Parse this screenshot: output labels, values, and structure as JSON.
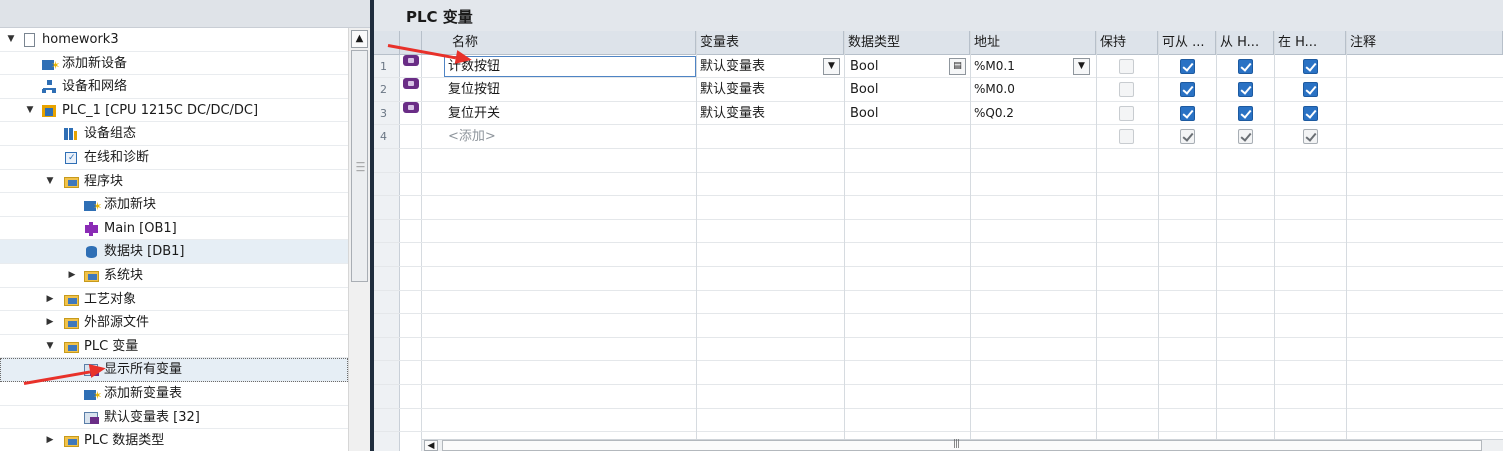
{
  "editor": {
    "title": "PLC 变量"
  },
  "tree": {
    "items": [
      {
        "label": "homework3",
        "level": 0,
        "toggle": "▼",
        "icon": "project-file-icon"
      },
      {
        "label": "添加新设备",
        "level": 1,
        "toggle": "",
        "icon": "add-device-icon"
      },
      {
        "label": "设备和网络",
        "level": 1,
        "toggle": "",
        "icon": "network-icon"
      },
      {
        "label": "PLC_1 [CPU 1215C DC/DC/DC]",
        "level": 1,
        "toggle": "▼",
        "icon": "plc-cpu-icon"
      },
      {
        "label": "设备组态",
        "level": 2,
        "toggle": "",
        "icon": "device-config-icon"
      },
      {
        "label": "在线和诊断",
        "level": 2,
        "toggle": "",
        "icon": "online-diagnostics-icon"
      },
      {
        "label": "程序块",
        "level": 2,
        "toggle": "▼",
        "icon": "folder-icon"
      },
      {
        "label": "添加新块",
        "level": 3,
        "toggle": "",
        "icon": "add-block-icon"
      },
      {
        "label": "Main [OB1]",
        "level": 3,
        "toggle": "",
        "icon": "ob-block-icon"
      },
      {
        "label": "数据块 [DB1]",
        "level": 3,
        "toggle": "",
        "icon": "data-block-icon",
        "highlight": true
      },
      {
        "label": "系统块",
        "level": 3,
        "toggle": "▶",
        "icon": "folder-icon"
      },
      {
        "label": "工艺对象",
        "level": 2,
        "toggle": "▶",
        "icon": "folder-icon"
      },
      {
        "label": "外部源文件",
        "level": 2,
        "toggle": "▶",
        "icon": "folder-icon"
      },
      {
        "label": "PLC 变量",
        "level": 2,
        "toggle": "▼",
        "icon": "folder-icon"
      },
      {
        "label": "显示所有变量",
        "level": 3,
        "toggle": "",
        "icon": "tag-table-icon",
        "selected": true
      },
      {
        "label": "添加新变量表",
        "level": 3,
        "toggle": "",
        "icon": "add-tag-table-icon"
      },
      {
        "label": "默认变量表 [32]",
        "level": 3,
        "toggle": "",
        "icon": "tag-table-icon"
      },
      {
        "label": "PLC 数据类型",
        "level": 2,
        "toggle": "▶",
        "icon": "folder-icon"
      }
    ]
  },
  "table": {
    "columns": [
      "名称",
      "变量表",
      "数据类型",
      "地址",
      "保持",
      "可从 ...",
      "从 H...",
      "在 H...",
      "注释"
    ],
    "rows": [
      {
        "no": "1",
        "name": "计数按钮",
        "table": "默认变量表",
        "type": "Bool",
        "address": "%M0.1",
        "retain": false,
        "accessible": true,
        "writable": true,
        "visible": true,
        "editing": true
      },
      {
        "no": "2",
        "name": "复位按钮",
        "table": "默认变量表",
        "type": "Bool",
        "address": "%M0.0",
        "retain": false,
        "accessible": true,
        "writable": true,
        "visible": true
      },
      {
        "no": "3",
        "name": "复位开关",
        "table": "默认变量表",
        "type": "Bool",
        "address": "%Q0.2",
        "retain": false,
        "accessible": true,
        "writable": true,
        "visible": true
      },
      {
        "no": "4",
        "name": "<添加>",
        "table": "",
        "type": "",
        "address": "",
        "retain": false,
        "accessible": true,
        "writable": true,
        "visible": true,
        "placeholder": true
      }
    ]
  },
  "colors": {
    "annotation": "#e8312a",
    "checkbox": "#2a72c4",
    "tag_icon": "#6a2d86",
    "splitter": "#1f2d3d"
  }
}
